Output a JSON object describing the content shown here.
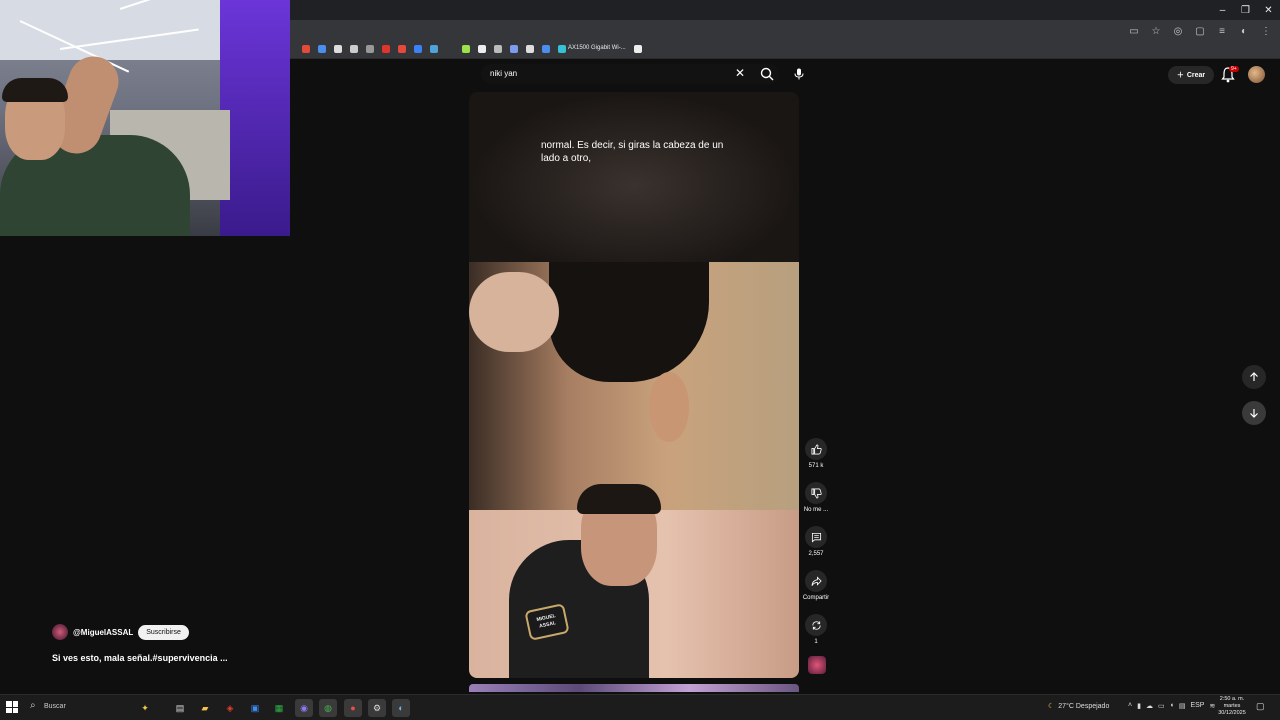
{
  "youtube": {
    "search_query": "niki yan",
    "create_label": "Crear",
    "notification_count": "9+"
  },
  "bookmarks": {
    "router_label": "AX1500 Gigabit Wi-..."
  },
  "video": {
    "caption": "normal. Es decir, si giras la cabeza de un lado a otro,",
    "badge_text": "MIGUEL ASSAL"
  },
  "actions": {
    "like_count": "571 k",
    "dislike_label": "No me ...",
    "comment_count": "2,557",
    "share_label": "Compartir",
    "remix_count": "1"
  },
  "channel": {
    "handle": "@MiguelASSAL",
    "subscribe_label": "Suscribirse",
    "video_title": "Si ves esto, mala señal.#supervivencia ..."
  },
  "taskbar": {
    "search_label": "Buscar",
    "weather": "27°C  Despejado",
    "language": "ESP",
    "time": "2:50 a. m.",
    "day": "martes",
    "date": "30/12/2025"
  },
  "colors": {
    "yt_bg": "#0f0f0f",
    "button_bg": "#272727",
    "notif_red": "#cc0000"
  }
}
